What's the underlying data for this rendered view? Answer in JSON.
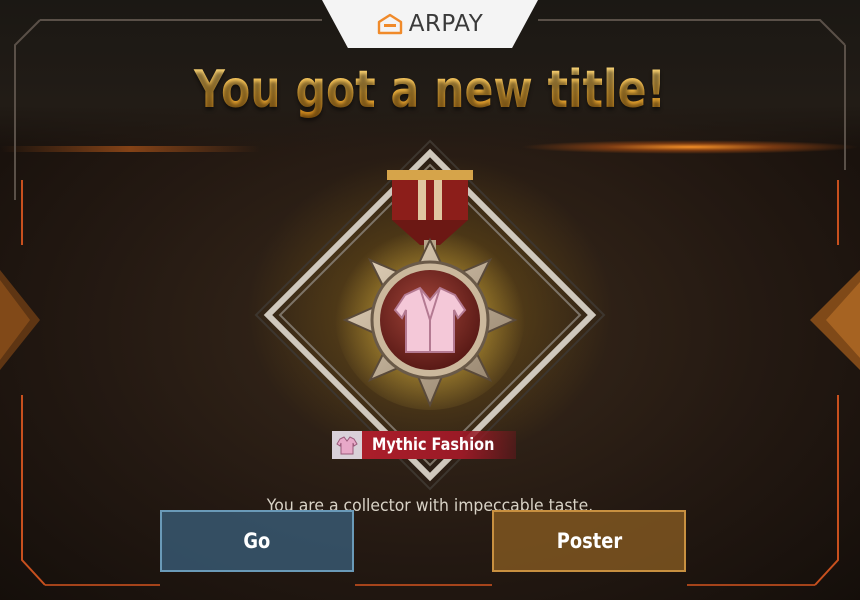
{
  "watermark": {
    "brand": "ARPAY",
    "logo_icon": "arpay-house-icon"
  },
  "reward": {
    "headline": "You got a new title!",
    "medal_icon": "robe-medal-icon",
    "title_icon": "robe-icon",
    "title_name": "Mythic Fashion",
    "description": "You are a collector with impeccable taste."
  },
  "actions": {
    "go_label": "Go",
    "poster_label": "Poster"
  },
  "colors": {
    "headline_gold": "#f3b43a",
    "title_chip_red": "#b01f2c",
    "go_button_blue": "#3c6482",
    "poster_button_amber": "#8c5f23",
    "frame_orange": "#c8501e"
  }
}
